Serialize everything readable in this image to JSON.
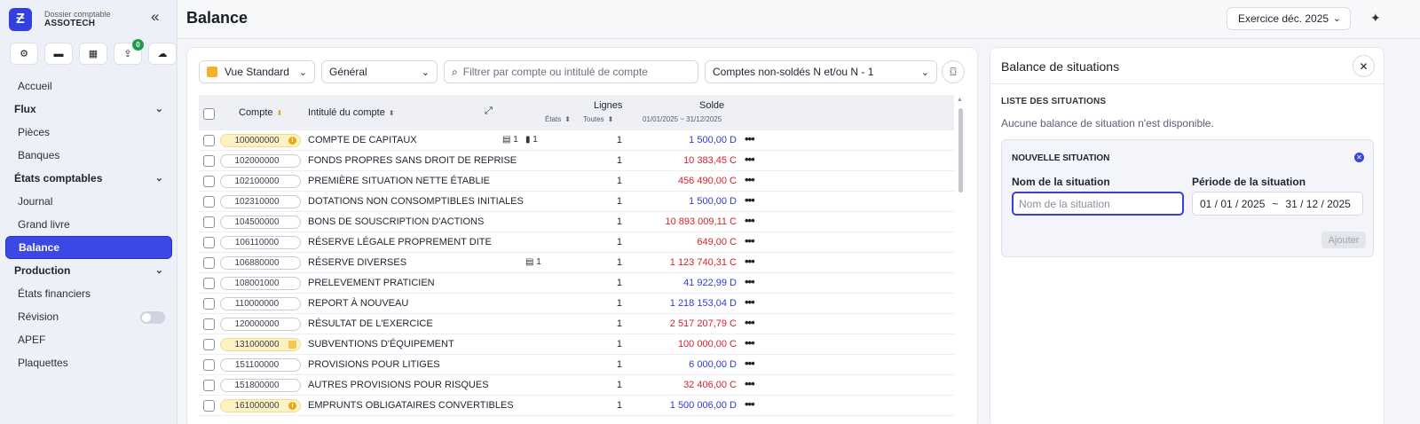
{
  "sidebar": {
    "brand_sub": "Dossier comptable",
    "brand_name": "ASSOTECH",
    "badge_count": "0",
    "items": [
      {
        "label": "Accueil",
        "kind": "item"
      },
      {
        "label": "Flux",
        "kind": "section"
      },
      {
        "label": "Pièces",
        "kind": "item"
      },
      {
        "label": "Banques",
        "kind": "item"
      },
      {
        "label": "États comptables",
        "kind": "section"
      },
      {
        "label": "Journal",
        "kind": "item"
      },
      {
        "label": "Grand livre",
        "kind": "item"
      },
      {
        "label": "Balance",
        "kind": "item",
        "active": true
      },
      {
        "label": "Production",
        "kind": "section"
      },
      {
        "label": "États financiers",
        "kind": "item"
      },
      {
        "label": "Révision",
        "kind": "item",
        "toggle": false
      },
      {
        "label": "APEF",
        "kind": "item"
      },
      {
        "label": "Plaquettes",
        "kind": "item"
      }
    ]
  },
  "header": {
    "title": "Balance",
    "exercise": "Exercice déc. 2025"
  },
  "filters": {
    "view": "Vue Standard",
    "journal": "Général",
    "search_placeholder": "Filtrer par compte ou intitulé de compte",
    "accounts": "Comptes non-soldés N et/ou N - 1"
  },
  "table": {
    "headers": {
      "account": "Compte",
      "label": "Intitulé du compte",
      "lines": "Lignes",
      "states": "États",
      "all": "Toutes",
      "balance": "Solde",
      "period": "01/01/2025 ~ 31/12/2025"
    },
    "rows": [
      {
        "account": "100000000",
        "label": "COMPTE DE CAPITAUX",
        "lines": "1",
        "balance": "1 500,00 D",
        "side": "D",
        "highlight": true,
        "mark": "info",
        "docs": [
          "1",
          "1"
        ]
      },
      {
        "account": "102000000",
        "label": "FONDS PROPRES SANS DROIT DE REPRISE",
        "lines": "1",
        "balance": "10 383,45 C",
        "side": "C"
      },
      {
        "account": "102100000",
        "label": "PREMIÈRE SITUATION NETTE ÉTABLIE",
        "lines": "1",
        "balance": "456 490,00 C",
        "side": "C"
      },
      {
        "account": "102310000",
        "label": "DOTATIONS NON CONSOMPTIBLES INITIALES",
        "lines": "1",
        "balance": "1 500,00 D",
        "side": "D"
      },
      {
        "account": "104500000",
        "label": "BONS DE SOUSCRIPTION D'ACTIONS",
        "lines": "1",
        "balance": "10 893 009,11 C",
        "side": "C"
      },
      {
        "account": "106110000",
        "label": "RÉSERVE LÉGALE PROPREMENT DITE",
        "lines": "1",
        "balance": "649,00 C",
        "side": "C"
      },
      {
        "account": "106880000",
        "label": "RÉSERVE DIVERSES",
        "lines": "1",
        "balance": "1 123 740,31 C",
        "side": "C",
        "docs": [
          "1"
        ]
      },
      {
        "account": "108001000",
        "label": "PRELEVEMENT PRATICIEN",
        "lines": "1",
        "balance": "41 922,99 D",
        "side": "D"
      },
      {
        "account": "110000000",
        "label": "REPORT À NOUVEAU",
        "lines": "1",
        "balance": "1 218 153,04 D",
        "side": "D"
      },
      {
        "account": "120000000",
        "label": "RÉSULTAT DE L'EXERCICE",
        "lines": "1",
        "balance": "2 517 207,79 C",
        "side": "C"
      },
      {
        "account": "131000000",
        "label": "SUBVENTIONS D'ÉQUIPEMENT",
        "lines": "1",
        "balance": "100 000,00 C",
        "side": "C",
        "highlight": true,
        "mark": "calendar"
      },
      {
        "account": "151100000",
        "label": "PROVISIONS POUR LITIGES",
        "lines": "1",
        "balance": "6 000,00 D",
        "side": "D"
      },
      {
        "account": "151800000",
        "label": "AUTRES PROVISIONS POUR RISQUES",
        "lines": "1",
        "balance": "32 406,00 C",
        "side": "C"
      },
      {
        "account": "161000000",
        "label": "EMPRUNTS OBLIGATAIRES CONVERTIBLES",
        "lines": "1",
        "balance": "1 500 006,00 D",
        "side": "D",
        "highlight": true,
        "mark": "info"
      }
    ]
  },
  "panel": {
    "title": "Balance de situations",
    "list_title": "LISTE DES SITUATIONS",
    "empty": "Aucune balance de situation n'est disponible.",
    "new_title": "NOUVELLE SITUATION",
    "name_label": "Nom de la situation",
    "name_placeholder": "Nom de la situation",
    "period_label": "Période de la situation",
    "period_start": "01 / 01 / 2025",
    "period_sep": "~",
    "period_end": "31 / 12 / 2025",
    "add_button": "Ajouter"
  },
  "colors": {
    "accent": "#3c48e6",
    "debit": "#2c3ecf",
    "credit": "#d4232b",
    "highlight": "#fdf2c4"
  }
}
